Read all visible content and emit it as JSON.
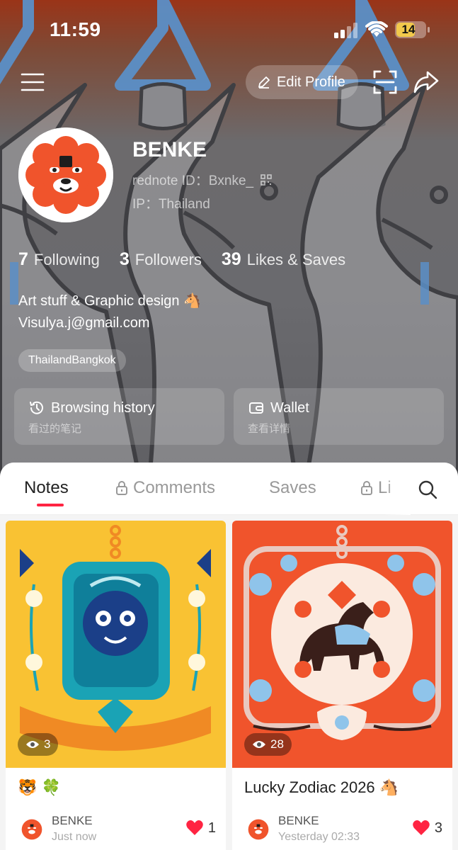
{
  "status_bar": {
    "time": "11:59",
    "battery": "14"
  },
  "top_nav": {
    "edit_profile_label": "Edit Profile"
  },
  "profile": {
    "name": "BENKE",
    "id_text": "rednote ID：Bxnke_",
    "ip_text": "IP：Thailand",
    "bio_line1": "Art stuff & Graphic design 🐴",
    "bio_line2": "Visulya.j@gmail.com",
    "location_tag": "ThailandBangkok"
  },
  "stats": [
    {
      "value": "7",
      "label": "Following"
    },
    {
      "value": "3",
      "label": "Followers"
    },
    {
      "value": "39",
      "label": "Likes & Saves"
    }
  ],
  "cards": {
    "history": {
      "title": "Browsing history",
      "subtitle": "看过的笔记"
    },
    "wallet": {
      "title": "Wallet",
      "subtitle": "查看详情"
    }
  },
  "tabs": [
    {
      "label": "Notes",
      "locked": false,
      "active": true
    },
    {
      "label": "Comments",
      "locked": true,
      "active": false
    },
    {
      "label": "Saves",
      "locked": false,
      "active": false
    },
    {
      "label": "Li",
      "locked": true,
      "active": false
    }
  ],
  "notes": [
    {
      "title": "🐯 🍀",
      "views": "3",
      "author": "BENKE",
      "time": "Just now",
      "likes": "1"
    },
    {
      "title": "Lucky Zodiac 2026 🐴",
      "views": "28",
      "author": "BENKE",
      "time": "Yesterday 02:33",
      "likes": "3"
    }
  ],
  "colors": {
    "accent": "#ff2442",
    "heart": "#ff2442",
    "note1_bg": "#f9c233",
    "note2_bg": "#f0542c"
  }
}
